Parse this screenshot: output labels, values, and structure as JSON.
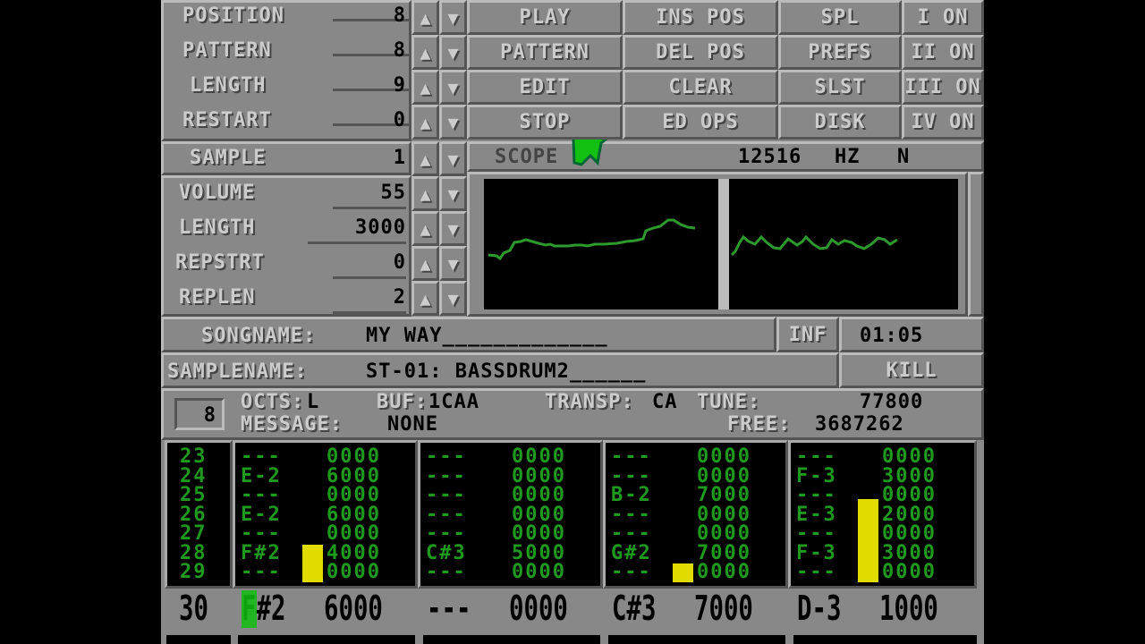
{
  "song_controls": [
    {
      "label": "POSITION",
      "value": "8"
    },
    {
      "label": "PATTERN",
      "value": "8"
    },
    {
      "label": "LENGTH",
      "value": "9"
    },
    {
      "label": "RESTART",
      "value": "0"
    }
  ],
  "arrows": {
    "up": "▲",
    "down": "▼"
  },
  "buttons": {
    "col1": [
      "PLAY",
      "PATTERN",
      "EDIT",
      "STOP"
    ],
    "col2": [
      "INS POS",
      "DEL POS",
      "CLEAR",
      "ED OPS"
    ],
    "col3": [
      "SPL",
      "PREFS",
      "SLST",
      "DISK"
    ],
    "channels": [
      "I ON",
      "II ON",
      "III ON",
      "IV ON"
    ]
  },
  "sample_controls": [
    {
      "label": "SAMPLE",
      "value": "1"
    },
    {
      "label": "VOLUME",
      "value": "55"
    },
    {
      "label": "LENGTH",
      "value": "3000"
    },
    {
      "label": "REPSTRT",
      "value": "0"
    },
    {
      "label": "REPLEN",
      "value": "2"
    }
  ],
  "scope": {
    "label": "SCOPE",
    "freq": "12516",
    "unit": "HZ",
    "mode": "N"
  },
  "songname": {
    "label": "SONGNAME:",
    "value": "MY WAY_____________",
    "info_button": "INF",
    "time": "01:05"
  },
  "samplename": {
    "label": "SAMPLENAME:",
    "value": "ST-01: BASSDRUM2______",
    "kill_button": "KILL"
  },
  "status": {
    "edit_step": "8",
    "octs_label": "OCTS:",
    "octs": "L",
    "buf_label": "BUF:",
    "buf": "1CAA",
    "transp_label": "TRANSP:",
    "transp": "CA",
    "tune_label": "TUNE:",
    "tune": "77800",
    "message_label": "MESSAGE:",
    "message": "NONE",
    "free_label": "FREE:",
    "free": "3687262"
  },
  "pattern": {
    "row_numbers": [
      "23",
      "24",
      "25",
      "26",
      "27",
      "28",
      "29"
    ],
    "tracks": [
      {
        "notes": [
          "---",
          "E-2",
          "---",
          "E-2",
          "---",
          "F#2",
          "---"
        ],
        "cmds": [
          "0000",
          "6000",
          "0000",
          "6000",
          "0000",
          "4000",
          "0000"
        ],
        "vu_level": 0.28
      },
      {
        "notes": [
          "---",
          "---",
          "---",
          "---",
          "---",
          "C#3",
          "---"
        ],
        "cmds": [
          "0000",
          "0000",
          "0000",
          "0000",
          "0000",
          "5000",
          "0000"
        ],
        "vu_level": 0
      },
      {
        "notes": [
          "---",
          "---",
          "B-2",
          "---",
          "---",
          "G#2",
          "---"
        ],
        "cmds": [
          "0000",
          "0000",
          "7000",
          "0000",
          "0000",
          "7000",
          "0000"
        ],
        "vu_level": 0.14
      },
      {
        "notes": [
          "---",
          "F-3",
          "---",
          "E-3",
          "---",
          "F-3",
          "---"
        ],
        "cmds": [
          "0000",
          "3000",
          "0000",
          "2000",
          "0000",
          "3000",
          "0000"
        ],
        "vu_level": 0.62
      }
    ],
    "current_row": {
      "number": "30",
      "cells": [
        {
          "note": "F#2",
          "cmd": "6000"
        },
        {
          "note": "---",
          "cmd": "0000"
        },
        {
          "note": "C#3",
          "cmd": "7000"
        },
        {
          "note": "D-3",
          "cmd": "1000"
        }
      ]
    }
  },
  "colors": {
    "pattern_green": "#1e9a1e",
    "vu_yellow": "#e0dc00",
    "panel_gray": "#888888",
    "cursor_green": "#11c011"
  }
}
